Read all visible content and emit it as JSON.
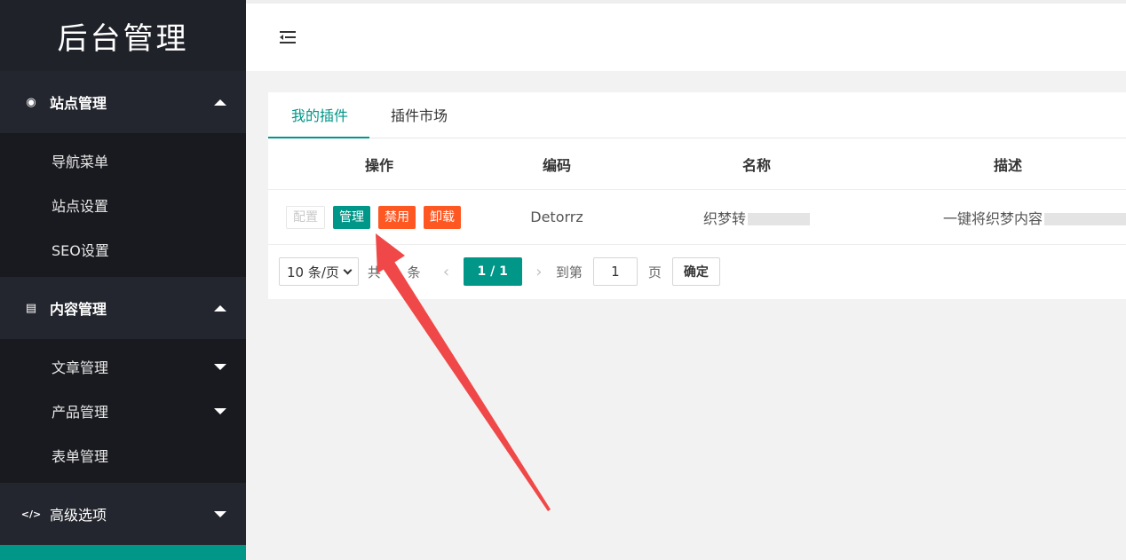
{
  "sidebar": {
    "logo": "后台管理",
    "groups": [
      {
        "label": "站点管理",
        "icon": "globe-icon",
        "expanded": true,
        "items": [
          {
            "label": "导航菜单"
          },
          {
            "label": "站点设置"
          },
          {
            "label": "SEO设置"
          }
        ]
      },
      {
        "label": "内容管理",
        "icon": "document-icon",
        "expanded": true,
        "items": [
          {
            "label": "文章管理"
          },
          {
            "label": "产品管理"
          },
          {
            "label": "表单管理"
          }
        ]
      },
      {
        "label": "高级选项",
        "icon": "code-icon",
        "expanded": false,
        "items": []
      }
    ],
    "group1_icon_glyph": "◉",
    "group2_icon_glyph": "▤",
    "group3_icon_glyph": "</>"
  },
  "topbar": {
    "toggle_icon": "menu-fold-icon"
  },
  "tabs": [
    {
      "label": "我的插件",
      "active": true
    },
    {
      "label": "插件市场",
      "active": false
    }
  ],
  "table": {
    "headers": [
      "操作",
      "编码",
      "名称",
      "描述"
    ],
    "rows": [
      {
        "actions": [
          "配置",
          "管理",
          "禁用",
          "卸载"
        ],
        "code": "Detorrz",
        "name": "织梦转",
        "description": "一键将织梦内容"
      }
    ]
  },
  "pagination": {
    "page_size": "10 条/页",
    "total_prefix": "共",
    "total_count": "1",
    "total_suffix": "条",
    "current": "1 / 1",
    "goto_label": "到第",
    "goto_value": "1",
    "page_unit": "页",
    "confirm": "确定"
  },
  "colors": {
    "accent": "#009688",
    "danger": "#ff5722",
    "arrow": "#f04848",
    "sidebar_bg": "#23262e"
  }
}
